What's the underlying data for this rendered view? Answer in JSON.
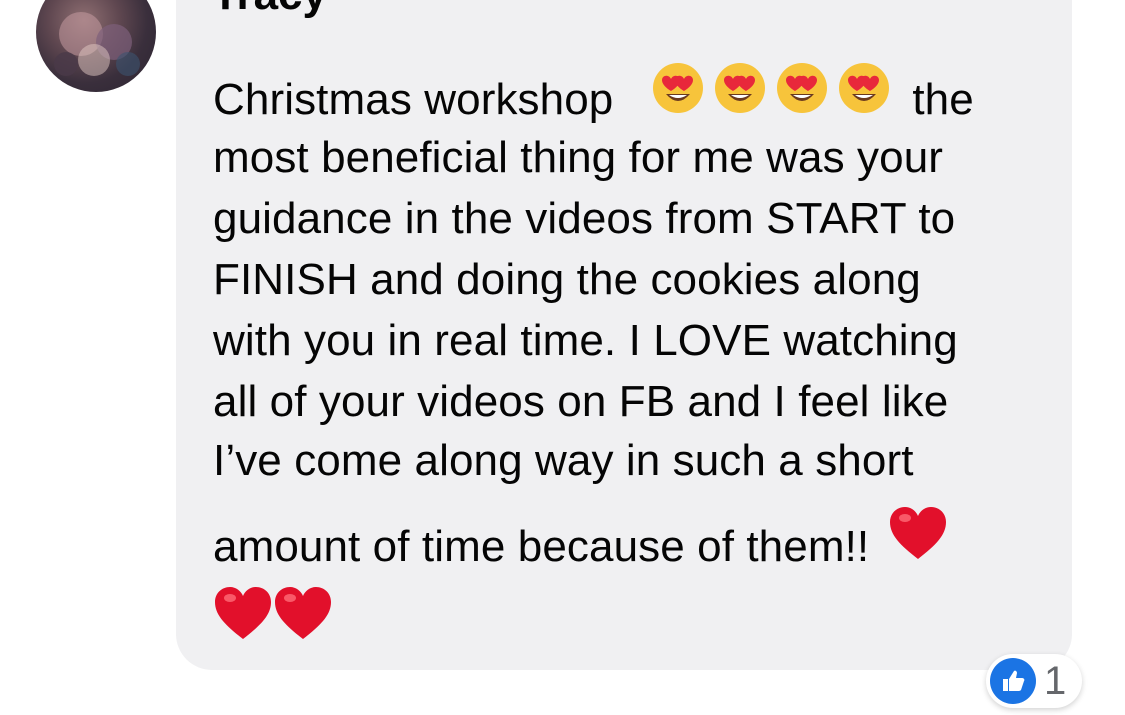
{
  "comment": {
    "author": "Tracy",
    "lines": [
      "Christmas workshop",
      "the",
      "most beneficial thing for me was your",
      "guidance in the videos from START to",
      "FINISH and doing the cookies along",
      "with you in real time. I LOVE watching",
      "all of your videos on FB and I feel like",
      "I’ve come along way in such a short",
      "amount of time because of them!!"
    ],
    "emojis": {
      "heart_eyes": "smiling-face-with-heart-eyes-icon",
      "red_heart": "red-heart-icon"
    }
  },
  "reaction": {
    "icon": "like-icon",
    "count": "1"
  },
  "colors": {
    "bubble": "#f0f0f2",
    "text": "#050505",
    "like_blue": "#1b74e4",
    "heart_red": "#e2102b",
    "emoji_yellow": "#f7c43b"
  }
}
